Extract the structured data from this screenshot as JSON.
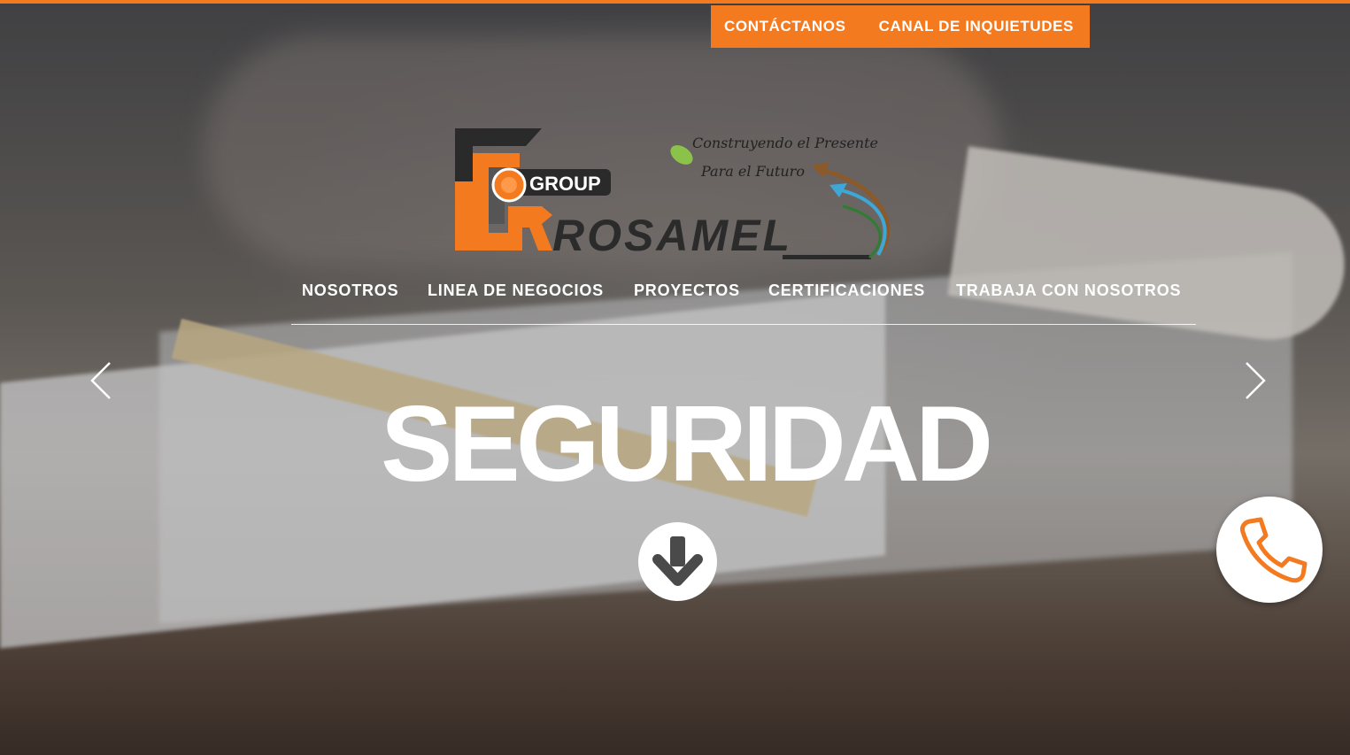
{
  "top_links": {
    "contact": "CONTÁCTANOS",
    "concerns": "CANAL DE INQUIETUDES"
  },
  "logo": {
    "brand_group": "GROUP",
    "brand_name": "ROSAMEL",
    "tagline_1": "Construyendo el Presente",
    "tagline_2": "Para el Futuro"
  },
  "nav": {
    "items": [
      "NOSOTROS",
      "LINEA DE NEGOCIOS",
      "PROYECTOS",
      "CERTIFICACIONES",
      "TRABAJA CON NOSOTROS"
    ]
  },
  "hero": {
    "title": "SEGURIDAD"
  },
  "icons": {
    "prev": "chevron-left-icon",
    "next": "chevron-right-icon",
    "scroll": "arrow-down-icon",
    "call": "phone-icon"
  },
  "colors": {
    "accent": "#f47a20",
    "text": "#ffffff"
  }
}
